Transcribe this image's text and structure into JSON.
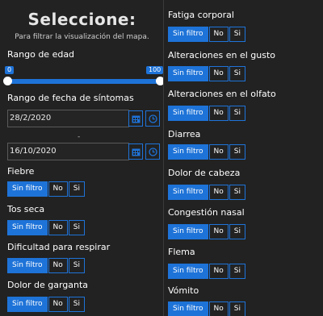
{
  "header": {
    "title": "Seleccione:",
    "subtitle": "Para filtrar la visualización del mapa."
  },
  "age_range": {
    "label": "Rango de edad",
    "min": "0",
    "max": "100",
    "range_low": 0,
    "range_high": 100
  },
  "symptom_dates": {
    "label": "Rango de fecha de síntomas",
    "start": "28/2/2020",
    "separator": "-",
    "end": "16/10/2020"
  },
  "filter_options": {
    "none": "Sin filtro",
    "no": "No",
    "yes": "Si"
  },
  "left_filters": [
    {
      "label": "Fiebre",
      "selected": "Sin filtro"
    },
    {
      "label": "Tos seca",
      "selected": "Sin filtro"
    },
    {
      "label": "Dificultad para respirar",
      "selected": "Sin filtro"
    },
    {
      "label": "Dolor de garganta",
      "selected": "Sin filtro"
    }
  ],
  "right_filters": [
    {
      "label": "Fatiga corporal",
      "selected": "Sin filtro"
    },
    {
      "label": "Alteraciones en el gusto",
      "selected": "Sin filtro"
    },
    {
      "label": "Alteraciones en el olfato",
      "selected": "Sin filtro"
    },
    {
      "label": "Diarrea",
      "selected": "Sin filtro"
    },
    {
      "label": "Dolor de cabeza",
      "selected": "Sin filtro"
    },
    {
      "label": "Congestión nasal",
      "selected": "Sin filtro"
    },
    {
      "label": "Flema",
      "selected": "Sin filtro"
    },
    {
      "label": "Vómito",
      "selected": "Sin filtro"
    }
  ],
  "icons": {
    "calendar": "calendar-icon",
    "clock": "clock-icon"
  },
  "colors": {
    "panel_bg": "#222222",
    "accent": "#1e73d8"
  }
}
